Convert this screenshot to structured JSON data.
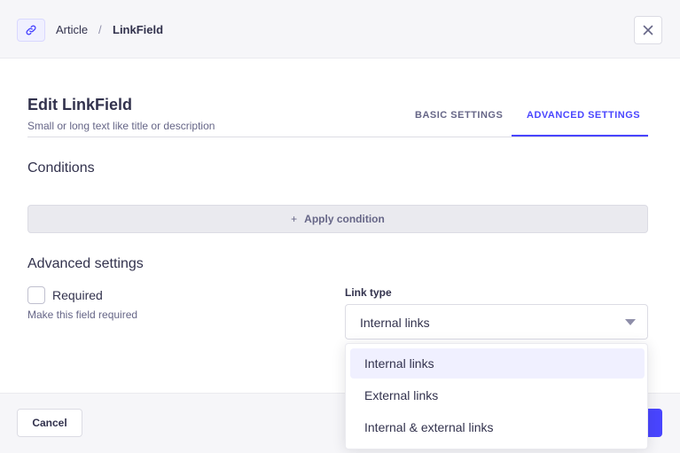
{
  "breadcrumb": {
    "parent": "Article",
    "separator": "/",
    "current": "LinkField"
  },
  "modal": {
    "title": "Edit LinkField",
    "subtitle": "Small or long text like title or description"
  },
  "tabs": [
    {
      "label": "BASIC SETTINGS",
      "active": false
    },
    {
      "label": "ADVANCED SETTINGS",
      "active": true
    }
  ],
  "conditions": {
    "heading": "Conditions",
    "apply_icon": "+",
    "apply_label": "Apply condition"
  },
  "advanced": {
    "heading": "Advanced settings",
    "required_label": "Required",
    "required_checked": false,
    "required_hint": "Make this field required",
    "link_type_label": "Link type",
    "link_type_value": "Internal links",
    "options": [
      "Internal links",
      "External links",
      "Internal & external links"
    ],
    "highlighted_option": "Internal links"
  },
  "footer": {
    "cancel_label": "Cancel"
  },
  "icons": {
    "badge": "link-icon",
    "close": "close-icon",
    "select": "chevron-down-icon"
  },
  "colors": {
    "accent": "#4945ff",
    "text": "#32324d",
    "muted": "#666687",
    "highlight": "#f0f0ff"
  }
}
